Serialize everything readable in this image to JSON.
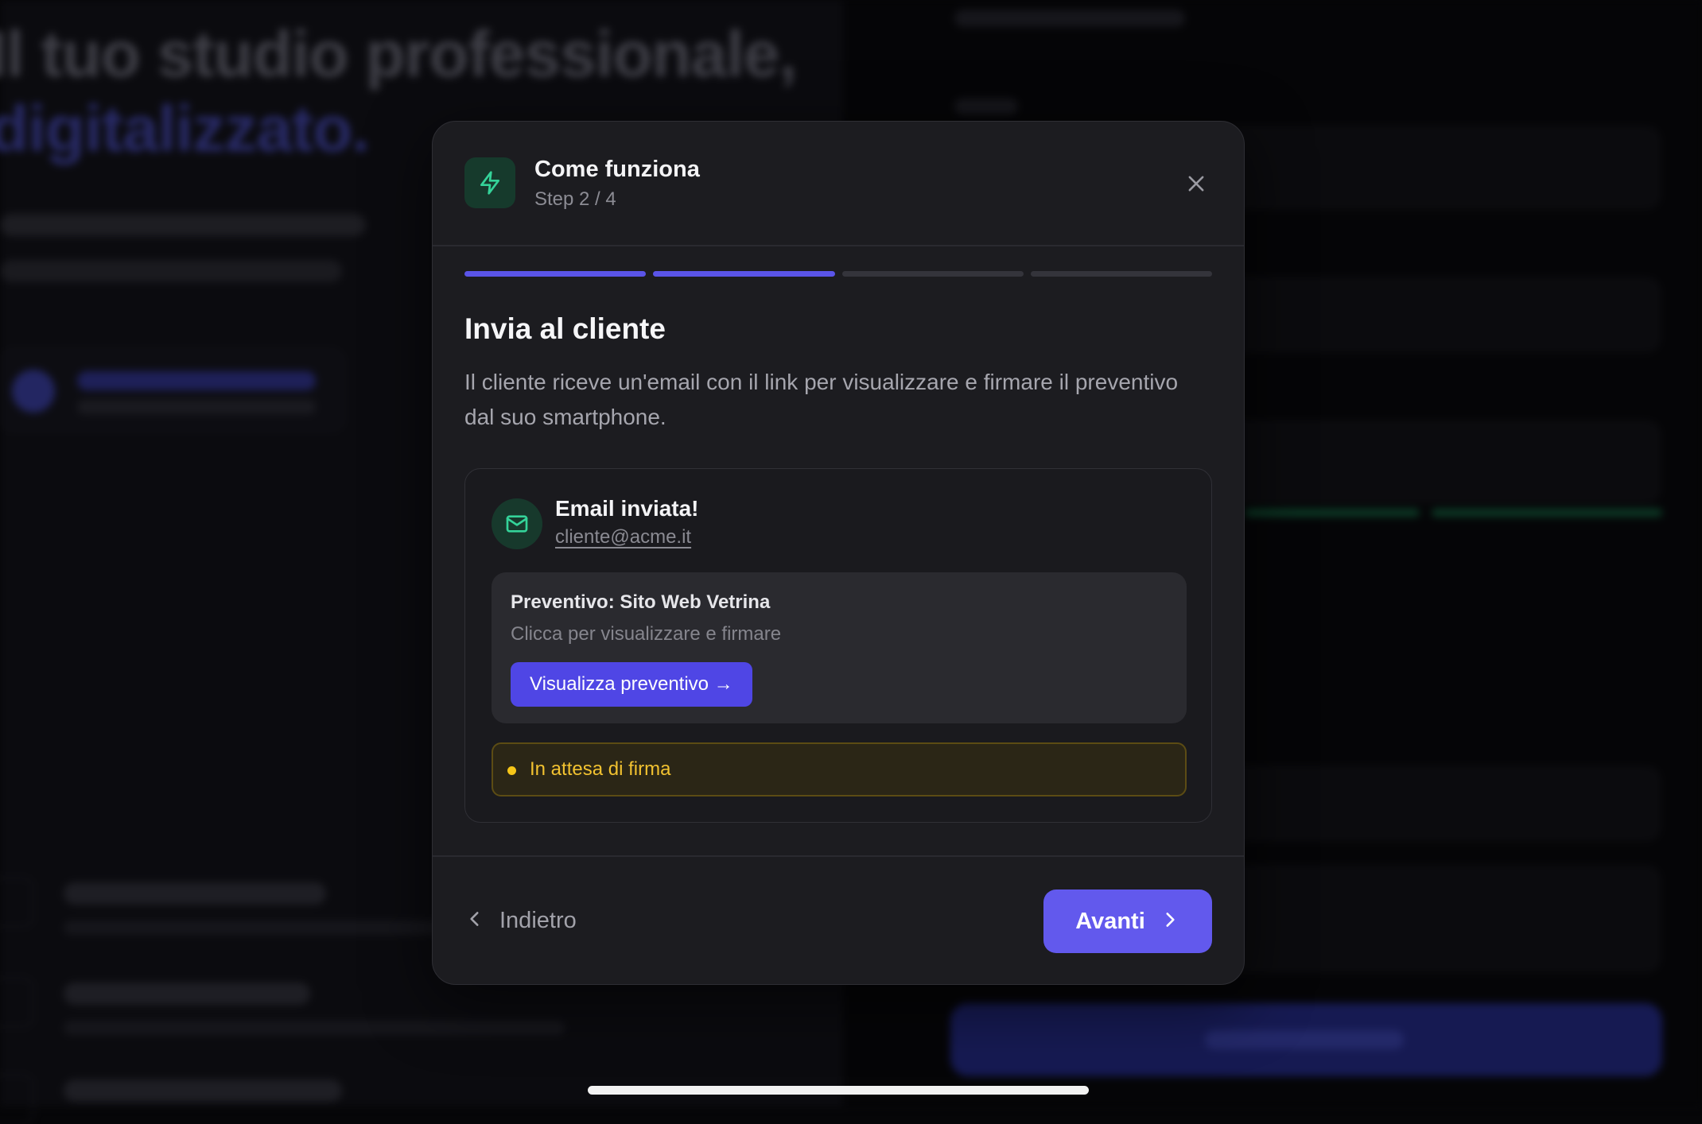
{
  "background": {
    "hero_line1": "Il tuo studio professionale,",
    "hero_line2": "digitalizzato."
  },
  "modal": {
    "header": {
      "icon": "lightning-icon",
      "title": "Come funziona",
      "step": "Step 2 / 4",
      "close_icon": "close-icon"
    },
    "progress": {
      "current_step": 2,
      "total_steps": 4
    },
    "title": "Invia al cliente",
    "description": "Il cliente riceve un'email con il link per visualizzare e firmare il preventivo dal suo smartphone.",
    "email_card": {
      "icon": "mail-icon",
      "title": "Email inviata!",
      "address": "cliente@acme.it",
      "quote": {
        "title": "Preventivo: Sito Web Vetrina",
        "subtitle": "Clicca per visualizzare e firmare",
        "button_label": "Visualizza preventivo →"
      },
      "status": {
        "label": "In attesa di firma",
        "color": "#f5c518"
      }
    },
    "footer": {
      "back_label": "Indietro",
      "next_label": "Avanti"
    }
  },
  "colors": {
    "accent": "#6259ed",
    "success": "#34d399",
    "warning": "#f5c518"
  }
}
